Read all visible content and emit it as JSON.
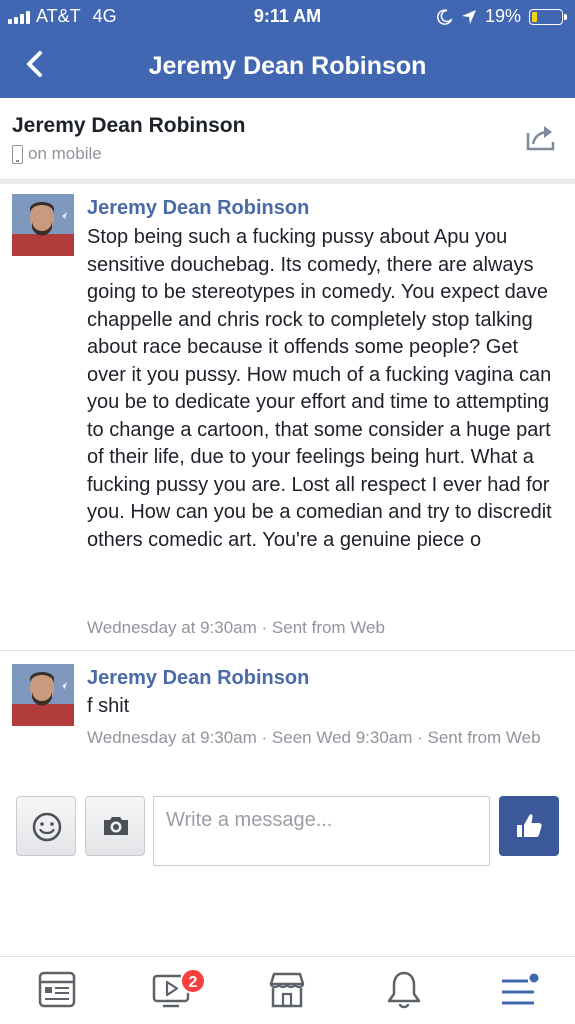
{
  "status_bar": {
    "carrier": "AT&T",
    "network": "4G",
    "time": "9:11 AM",
    "battery_percent": "19%",
    "battery_level": 0.19,
    "battery_color": "#f5d311"
  },
  "header": {
    "title": "Jeremy Dean Robinson",
    "back_icon": "chevron-left-icon",
    "bg_color": "#4267b2"
  },
  "contact": {
    "name": "Jeremy Dean Robinson",
    "status": "on mobile",
    "status_icon": "phone-icon",
    "share_icon": "share-icon"
  },
  "messages": [
    {
      "sender": "Jeremy Dean Robinson",
      "text": "Stop being such a fucking pussy about Apu you sensitive douchebag. Its comedy, there are always going to be stereotypes in comedy. You expect dave chappelle and chris rock to completely stop talking about race because it offends some people? Get over it you pussy. How much of a fucking vagina can you be to dedicate your effort and time to attempting to change a cartoon, that some consider a huge part of their life, due to your feelings being hurt. What a fucking pussy you are. Lost all respect I ever had for you. How can you be a comedian and try to discredit others comedic art. You're a genuine piece o",
      "meta": "Wednesday at 9:30am · Sent from Web"
    },
    {
      "sender": "Jeremy Dean Robinson",
      "text": "f shit",
      "meta": "Wednesday at 9:30am · Seen Wed 9:30am · Sent from Web"
    }
  ],
  "composer": {
    "placeholder": "Write a message...",
    "emoji_icon": "smiley-icon",
    "camera_icon": "camera-icon",
    "like_icon": "thumbs-up-icon"
  },
  "tabbar": {
    "tabs": [
      "news-feed-icon",
      "video-icon",
      "marketplace-icon",
      "notifications-bell-icon",
      "menu-icon"
    ],
    "video_badge": "2",
    "accent": "#4267b2"
  }
}
